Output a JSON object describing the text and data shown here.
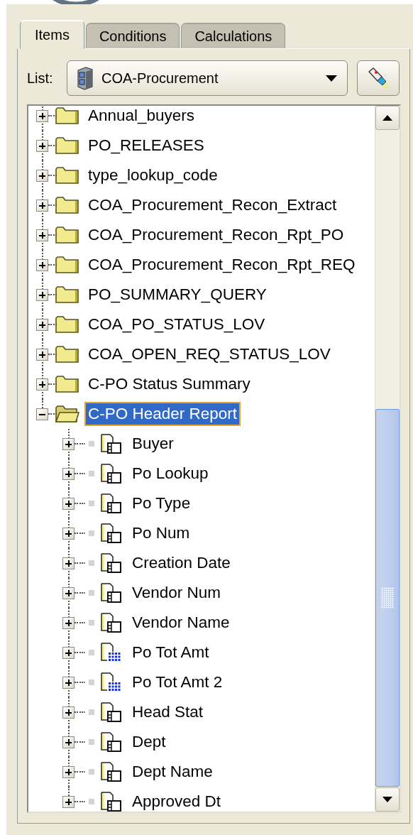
{
  "tabs": [
    {
      "label": "Items",
      "selected": true
    },
    {
      "label": "Conditions",
      "selected": false
    },
    {
      "label": "Calculations",
      "selected": false
    }
  ],
  "list": {
    "label": "List:",
    "value": "COA-Procurement"
  },
  "tree": [
    {
      "label": "Annual_buyers",
      "expanded": false,
      "selected": false
    },
    {
      "label": "PO_RELEASES",
      "expanded": false,
      "selected": false
    },
    {
      "label": "type_lookup_code",
      "expanded": false,
      "selected": false
    },
    {
      "label": "COA_Procurement_Recon_Extract",
      "expanded": false,
      "selected": false
    },
    {
      "label": "COA_Procurement_Recon_Rpt_PO",
      "expanded": false,
      "selected": false
    },
    {
      "label": "COA_Procurement_Recon_Rpt_REQ",
      "expanded": false,
      "selected": false
    },
    {
      "label": "PO_SUMMARY_QUERY",
      "expanded": false,
      "selected": false
    },
    {
      "label": "COA_PO_STATUS_LOV",
      "expanded": false,
      "selected": false
    },
    {
      "label": "COA_OPEN_REQ_STATUS_LOV",
      "expanded": false,
      "selected": false
    },
    {
      "label": "C-PO Status Summary",
      "expanded": false,
      "selected": false
    },
    {
      "label": "C-PO Header Report",
      "expanded": true,
      "selected": true,
      "children": [
        {
          "label": "Buyer",
          "kind": "item",
          "expanded": false,
          "selected": false
        },
        {
          "label": "Po Lookup",
          "kind": "item",
          "expanded": false,
          "selected": false
        },
        {
          "label": "Po Type",
          "kind": "item",
          "expanded": false,
          "selected": false
        },
        {
          "label": "Po Num",
          "kind": "item",
          "expanded": false,
          "selected": false
        },
        {
          "label": "Creation Date",
          "kind": "item",
          "expanded": false,
          "selected": false
        },
        {
          "label": "Vendor Num",
          "kind": "item",
          "expanded": false,
          "selected": false
        },
        {
          "label": "Vendor Name",
          "kind": "item",
          "expanded": false,
          "selected": false
        },
        {
          "label": "Po Tot Amt",
          "kind": "numeric",
          "expanded": false,
          "selected": false
        },
        {
          "label": "Po Tot Amt 2",
          "kind": "numeric",
          "expanded": false,
          "selected": false
        },
        {
          "label": "Head Stat",
          "kind": "item",
          "expanded": false,
          "selected": false
        },
        {
          "label": "Dept",
          "kind": "item",
          "expanded": false,
          "selected": false
        },
        {
          "label": "Dept Name",
          "kind": "item",
          "expanded": false,
          "selected": false
        },
        {
          "label": "Approved Dt",
          "kind": "item",
          "expanded": false,
          "selected": false
        }
      ]
    }
  ]
}
